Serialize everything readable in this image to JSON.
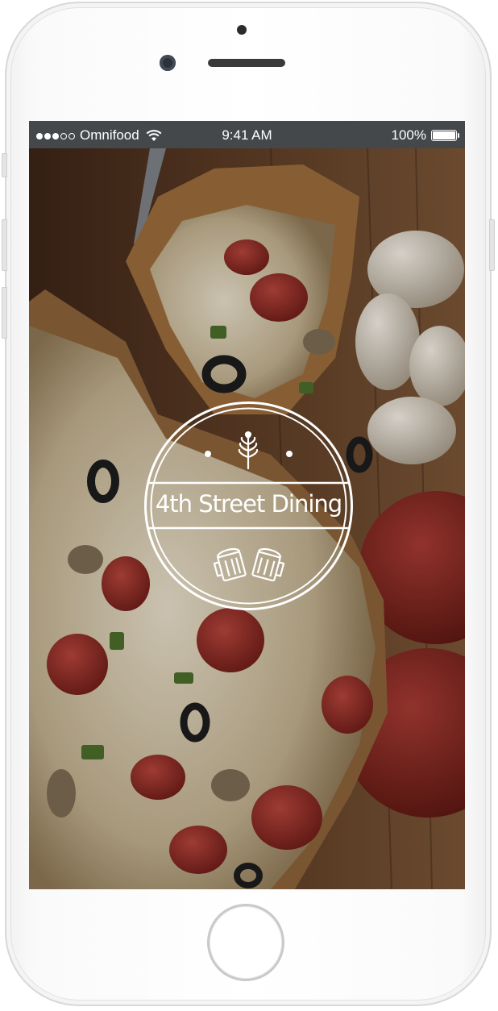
{
  "status_bar": {
    "carrier": "Omnifood",
    "time": "9:41 AM",
    "battery": "100%",
    "signal_full_dots": 3,
    "signal_empty_dots": 2
  },
  "splash": {
    "logo_text": "4th Street Dining",
    "top_icon": "wheat-icon",
    "bottom_icon": "beer-mugs-icon"
  },
  "background": {
    "subject": "pizza-photo",
    "accent": "#8a2b22",
    "wood": "#6a4a2e"
  },
  "device": {
    "body_color": "#ffffff",
    "status_bar_color": "#45484a"
  }
}
